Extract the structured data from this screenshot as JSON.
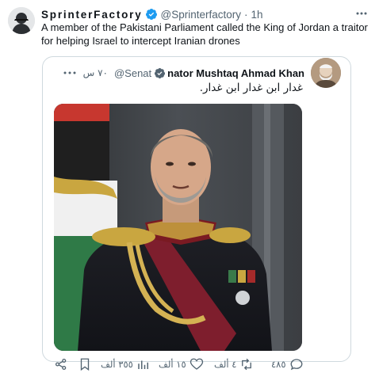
{
  "author": {
    "display_name": "SprinterFactory",
    "handle": "@Sprinterfactory",
    "separator": "·",
    "time": "1h"
  },
  "tweet_text": "A member of the Pakistani Parliament called the King of Jordan a traitor for helping Israel to intercept Iranian drones",
  "quote": {
    "name": "nator Mushtaq Ahmad Khan",
    "handle": "@Senat",
    "time": "٧٠ س",
    "text": "غدار ابن غدار ابن غدار."
  },
  "actions": {
    "views": "٣٥٥ ألف",
    "retweets": "٤ ألف",
    "likes": "١٥ ألف",
    "replies": "٤٨٥"
  },
  "colors": {
    "verified": "#1d9bf0",
    "muted": "#536471",
    "border": "#cfd9de"
  },
  "icons": [
    "verified-badge-icon",
    "more-icon",
    "share-icon",
    "bookmark-icon",
    "views-icon",
    "like-icon",
    "retweet-icon",
    "reply-icon"
  ]
}
